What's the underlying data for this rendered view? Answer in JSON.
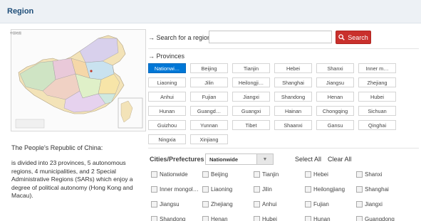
{
  "header": {
    "title": "Region"
  },
  "map": {
    "caption": "中国地图"
  },
  "left": {
    "intro": "The People's Republic of China:",
    "description": "is divided into 23 provinces, 5 autonomous regions, 4 municipalities, and 2 Special Administrative Regions (SARs) which enjoy a degree of political autonomy (Hong Kong and Macau)."
  },
  "search": {
    "arrow": "→",
    "label": "Search for a region",
    "value": "",
    "button_label": "Search"
  },
  "provinces": {
    "arrow": "→",
    "title": "Provinces",
    "items": [
      "Nationwi…",
      "Beijing",
      "Tianjin",
      "Hebei",
      "Shanxi",
      "Inner m…",
      "Liaoning",
      "Jilin",
      "Heilongji…",
      "Shanghai",
      "Jiangsu",
      "Zhejiang",
      "Anhui",
      "Fujian",
      "Jiangxi",
      "Shandong",
      "Henan",
      "Hubei",
      "Hunan",
      "Guangd…",
      "Guangxi",
      "Hainan",
      "Chongqing",
      "Sichuan",
      "Guizhou",
      "Yunnan",
      "Tibet",
      "Shaanxi",
      "Gansu",
      "Qinghai",
      "Ningxia",
      "Xinjiang"
    ]
  },
  "cities": {
    "label": "Cities/Prefectures",
    "select_value": "Nationwide",
    "select_all": "Select All",
    "clear_all": "Clear All",
    "items": [
      "Nationwide",
      "Beijing",
      "Tianjin",
      "Hebei",
      "Shanxi",
      "Inner mongol…",
      "Liaoning",
      "Jilin",
      "Heilongjiang",
      "Shanghai",
      "Jiangsu",
      "Zhejiang",
      "Anhui",
      "Fujian",
      "Jiangxi",
      "Shandong",
      "Henan",
      "Hubei",
      "Hunan",
      "Guangdong"
    ]
  },
  "colors": {
    "accent": "#0077d6",
    "search_button": "#c9302c",
    "header_bg": "#edf1f5",
    "title": "#1f4e79"
  }
}
